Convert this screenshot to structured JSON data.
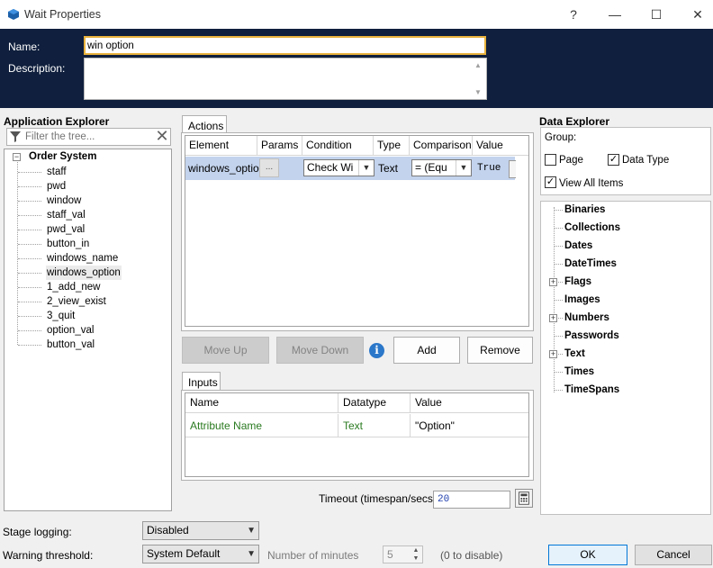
{
  "window": {
    "title": "Wait Properties",
    "help_glyph": "?",
    "min_glyph": "—",
    "max_glyph": "☐",
    "close_glyph": "✕"
  },
  "header": {
    "name_label": "Name:",
    "name_value": "win option",
    "description_label": "Description:",
    "description_value": ""
  },
  "app_explorer": {
    "title": "Application Explorer",
    "filter_placeholder": "Filter the tree...",
    "root_label": "Order System",
    "root_expander": "−",
    "items": [
      "staff",
      "pwd",
      "window",
      "staff_val",
      "pwd_val",
      "button_in",
      "windows_name",
      "windows_option",
      "1_add_new",
      "2_view_exist",
      "3_quit",
      "option_val",
      "button_val"
    ],
    "selected_index": 7
  },
  "actions": {
    "tab_label": "Actions",
    "columns": [
      "Element",
      "Params",
      "Condition",
      "Type",
      "Comparison",
      "Value"
    ],
    "row": {
      "element": "windows_option",
      "params": "...",
      "condition": "Check Wi",
      "type": "Text",
      "comparison": "= (Equ",
      "value": "True"
    }
  },
  "buttons": {
    "move_up": "Move Up",
    "move_down": "Move Down",
    "info": "i",
    "add": "Add",
    "remove": "Remove"
  },
  "inputs": {
    "tab_label": "Inputs",
    "columns": [
      "Name",
      "Datatype",
      "Value"
    ],
    "row": {
      "name": "Attribute Name",
      "datatype": "Text",
      "value": "\"Option\""
    }
  },
  "timeout": {
    "label": "Timeout (timespan/secs):",
    "value": "20"
  },
  "data_explorer": {
    "title": "Data Explorer",
    "group_label": "Group:",
    "page_label": "Page",
    "page_checked": false,
    "data_type_label": "Data Type",
    "data_type_checked": true,
    "view_all_label": "View All Items",
    "view_all_checked": true,
    "items": [
      "Binaries",
      "Collections",
      "Dates",
      "DateTimes",
      "Flags",
      "Images",
      "Numbers",
      "Passwords",
      "Text",
      "Times",
      "TimeSpans"
    ],
    "expandable": [
      "Flags",
      "Numbers",
      "Text"
    ]
  },
  "bottom": {
    "stage_logging_label": "Stage logging:",
    "stage_logging_value": "Disabled",
    "warning_label": "Warning threshold:",
    "warning_value": "System Default",
    "minutes_label": "Number of minutes",
    "minutes_value": "5",
    "disable_hint": "(0 to disable)",
    "ok": "OK",
    "cancel": "Cancel"
  },
  "colors": {
    "header_bg": "#0f1f3d",
    "selection": "#c3d3ed",
    "accent": "#0078d7",
    "name_focus": "#e8b23c",
    "input_green": "#2a7a20"
  }
}
